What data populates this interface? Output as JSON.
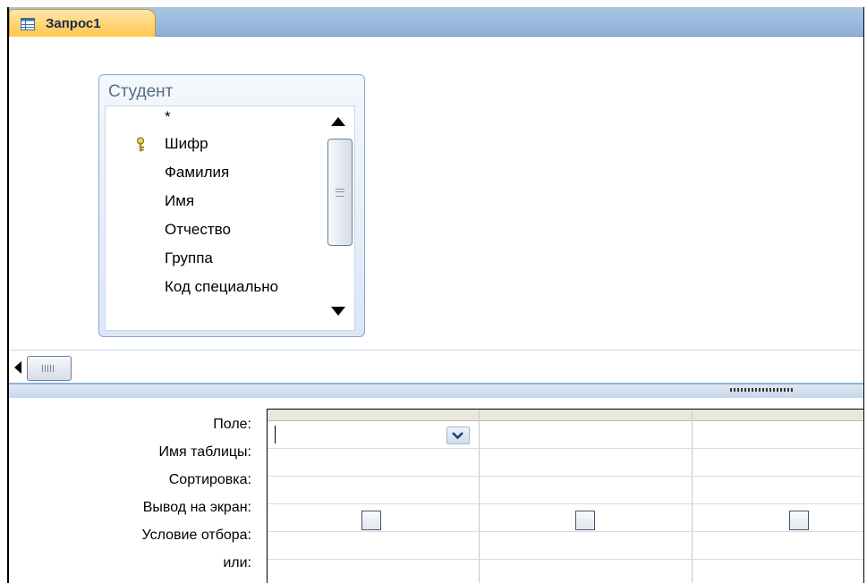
{
  "window": {
    "tab_label": "Запрос1",
    "accent_color": "#ffc64d",
    "tabstrip_color": "#a9c4e3"
  },
  "table_box": {
    "title": "Студент",
    "fields": [
      "*",
      "Шифр",
      "Фамилия",
      "Имя",
      "Отчество",
      "Группа",
      "Код специально"
    ],
    "primary_key_field": "Шифр",
    "icons": [
      "key-icon",
      "scroll-up-arrow-icon",
      "scroll-down-arrow-icon"
    ]
  },
  "query_grid": {
    "row_labels": [
      "Поле:",
      "Имя таблицы:",
      "Сортировка:",
      "Вывод на экран:",
      "Условие отбора:",
      "или:"
    ],
    "columns": [
      {
        "field": "",
        "show": false
      },
      {
        "field": "",
        "show": false
      },
      {
        "field": "",
        "show": false
      }
    ],
    "icons": [
      "dropdown-chevron-icon"
    ]
  }
}
